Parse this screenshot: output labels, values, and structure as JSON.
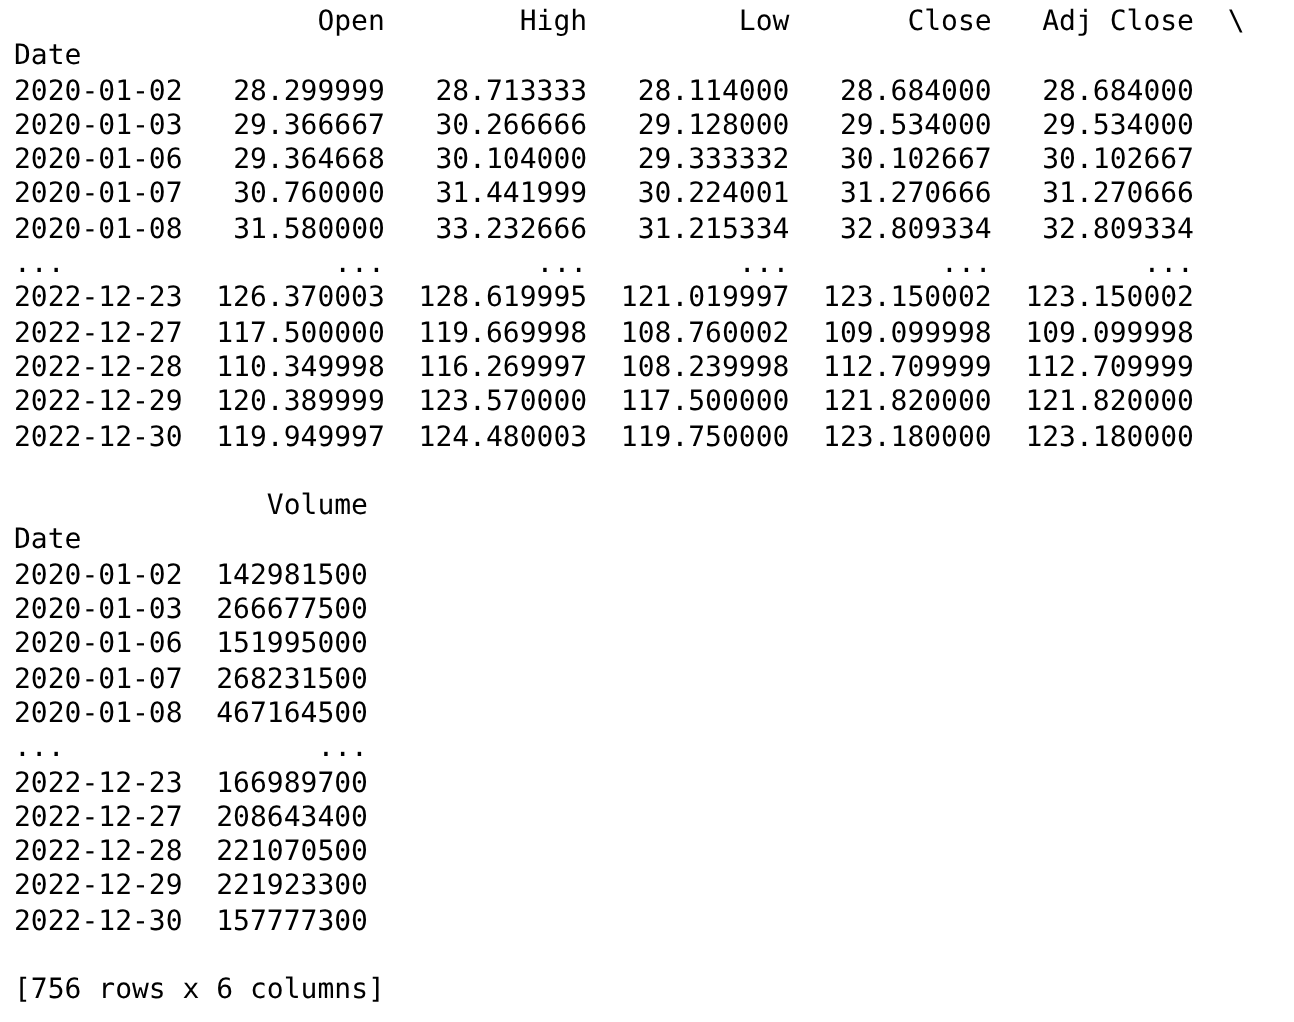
{
  "frames": [
    {
      "index_name": "Date",
      "columns": [
        "Open",
        "High",
        "Low",
        "Close",
        "Adj Close"
      ],
      "continuation": "\\",
      "rows": [
        {
          "index": "2020-01-02",
          "values": [
            "28.299999",
            "28.713333",
            "28.114000",
            "28.684000",
            "28.684000"
          ]
        },
        {
          "index": "2020-01-03",
          "values": [
            "29.366667",
            "30.266666",
            "29.128000",
            "29.534000",
            "29.534000"
          ]
        },
        {
          "index": "2020-01-06",
          "values": [
            "29.364668",
            "30.104000",
            "29.333332",
            "30.102667",
            "30.102667"
          ]
        },
        {
          "index": "2020-01-07",
          "values": [
            "30.760000",
            "31.441999",
            "30.224001",
            "31.270666",
            "31.270666"
          ]
        },
        {
          "index": "2020-01-08",
          "values": [
            "31.580000",
            "33.232666",
            "31.215334",
            "32.809334",
            "32.809334"
          ]
        },
        {
          "index": "...",
          "values": [
            "...",
            "...",
            "...",
            "...",
            "..."
          ]
        },
        {
          "index": "2022-12-23",
          "values": [
            "126.370003",
            "128.619995",
            "121.019997",
            "123.150002",
            "123.150002"
          ]
        },
        {
          "index": "2022-12-27",
          "values": [
            "117.500000",
            "119.669998",
            "108.760002",
            "109.099998",
            "109.099998"
          ]
        },
        {
          "index": "2022-12-28",
          "values": [
            "110.349998",
            "116.269997",
            "108.239998",
            "112.709999",
            "112.709999"
          ]
        },
        {
          "index": "2022-12-29",
          "values": [
            "120.389999",
            "123.570000",
            "117.500000",
            "121.820000",
            "121.820000"
          ]
        },
        {
          "index": "2022-12-30",
          "values": [
            "119.949997",
            "124.480003",
            "119.750000",
            "123.180000",
            "123.180000"
          ]
        }
      ]
    },
    {
      "index_name": "Date",
      "columns": [
        "Volume"
      ],
      "rows": [
        {
          "index": "2020-01-02",
          "values": [
            "142981500"
          ]
        },
        {
          "index": "2020-01-03",
          "values": [
            "266677500"
          ]
        },
        {
          "index": "2020-01-06",
          "values": [
            "151995000"
          ]
        },
        {
          "index": "2020-01-07",
          "values": [
            "268231500"
          ]
        },
        {
          "index": "2020-01-08",
          "values": [
            "467164500"
          ]
        },
        {
          "index": "...",
          "values": [
            "..."
          ]
        },
        {
          "index": "2022-12-23",
          "values": [
            "166989700"
          ]
        },
        {
          "index": "2022-12-27",
          "values": [
            "208643400"
          ]
        },
        {
          "index": "2022-12-28",
          "values": [
            "221070500"
          ]
        },
        {
          "index": "2022-12-29",
          "values": [
            "221923300"
          ]
        },
        {
          "index": "2022-12-30",
          "values": [
            "157777300"
          ]
        }
      ]
    }
  ],
  "summary": "[756 rows x 6 columns]"
}
